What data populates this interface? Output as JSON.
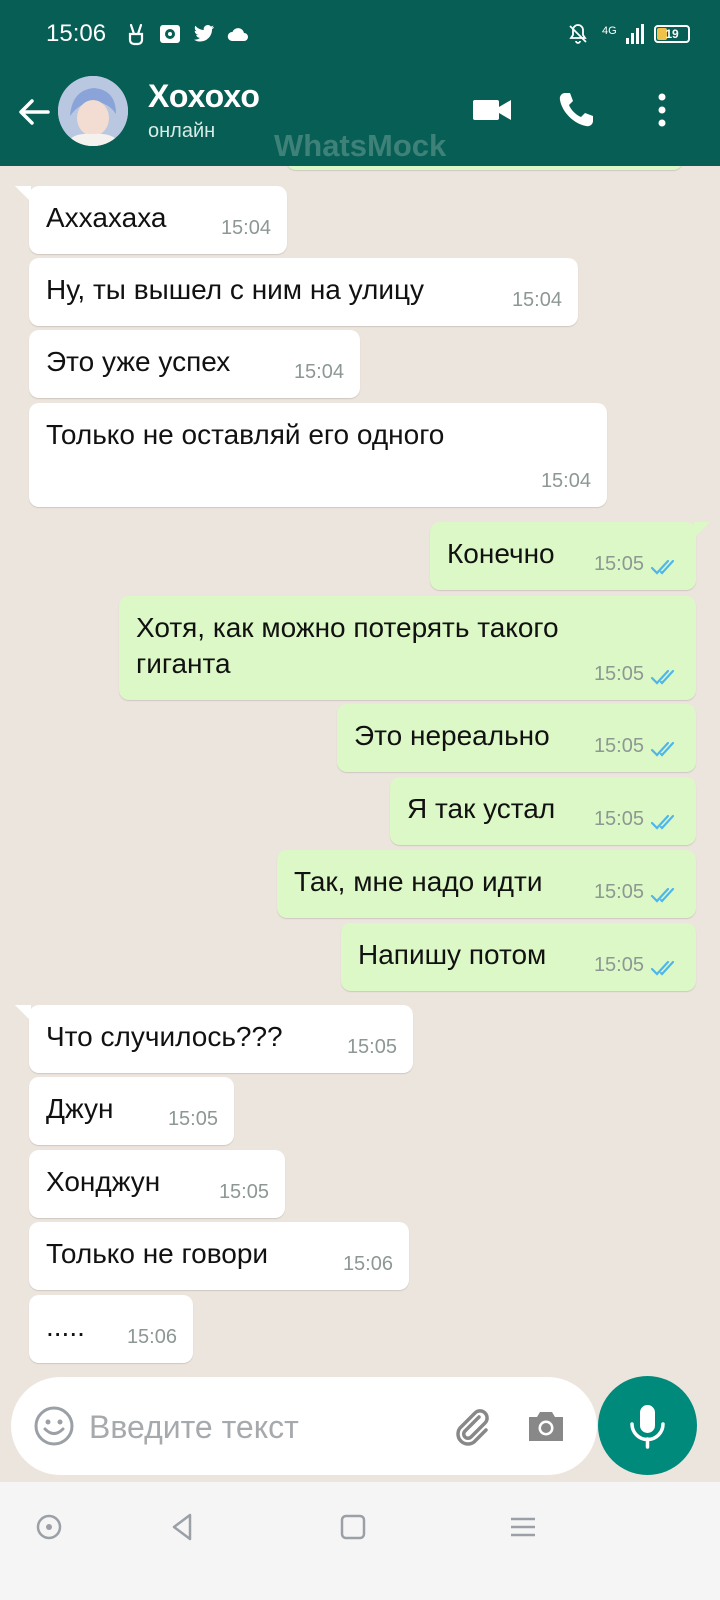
{
  "status_bar": {
    "time": "15:06",
    "network": "4G",
    "battery": "19",
    "icons": [
      "victory-hand-icon",
      "ring-icon",
      "twitter-icon",
      "cloud-icon",
      "mute-bell-icon",
      "signal-icon",
      "battery-icon"
    ]
  },
  "header": {
    "contact_name": "Хохохо",
    "contact_status": "онлайн",
    "watermark": "WhatsMock"
  },
  "messages": [
    {
      "dir": "in",
      "text": "Аххахаха",
      "time": "15:04"
    },
    {
      "dir": "in",
      "text": "Ну, ты вышел с ним на улицу",
      "time": "15:04"
    },
    {
      "dir": "in",
      "text": "Это уже успех",
      "time": "15:04"
    },
    {
      "dir": "in",
      "text": "Только не оставляй его одного",
      "time": "15:04"
    },
    {
      "dir": "out",
      "text": "Конечно",
      "time": "15:05",
      "read": true
    },
    {
      "dir": "out",
      "text": "Хотя, как можно потерять такого\nгиганта",
      "time": "15:05",
      "read": true
    },
    {
      "dir": "out",
      "text": "Это нереально",
      "time": "15:05",
      "read": true
    },
    {
      "dir": "out",
      "text": "Я так устал",
      "time": "15:05",
      "read": true
    },
    {
      "dir": "out",
      "text": "Так, мне надо идти",
      "time": "15:05",
      "read": true
    },
    {
      "dir": "out",
      "text": "Напишу потом",
      "time": "15:05",
      "read": true
    },
    {
      "dir": "in",
      "text": "Что случилось???",
      "time": "15:05"
    },
    {
      "dir": "in",
      "text": "Джун",
      "time": "15:05"
    },
    {
      "dir": "in",
      "text": "Хонджун",
      "time": "15:05"
    },
    {
      "dir": "in",
      "text": "Только не говори",
      "time": "15:06"
    },
    {
      "dir": "in",
      "text": ".....",
      "time": "15:06"
    }
  ],
  "input": {
    "placeholder": "Введите текст"
  },
  "colors": {
    "header": "#075e54",
    "chat_background": "#ece5dd",
    "incoming_bubble": "#ffffff",
    "outgoing_bubble": "#dcf8c6",
    "read_ticks": "#4fb6ec",
    "mic_button": "#008a7c"
  }
}
